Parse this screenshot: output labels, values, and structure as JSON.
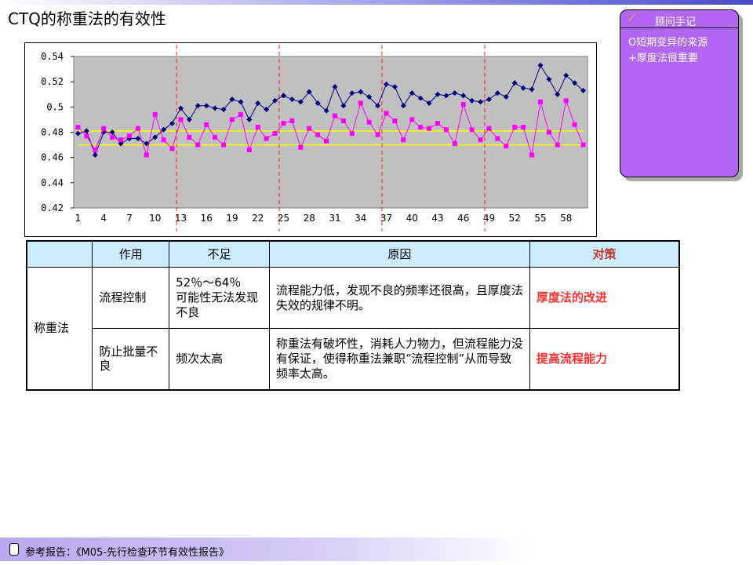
{
  "slide": {
    "title": "CTQ的称重法的有效性"
  },
  "note": {
    "header": "顾问手记",
    "lines": [
      "Ο短期变异的来源",
      "+厚度法很重要"
    ]
  },
  "chart_data": {
    "type": "line",
    "title": "",
    "xlabel": "",
    "ylabel": "",
    "ylim": [
      0.42,
      0.54
    ],
    "yticks": [
      "0.42",
      "0.44",
      "0.46",
      "0.48",
      "0.5",
      "0.52",
      "0.54"
    ],
    "xlim": [
      1,
      60
    ],
    "xticks": [
      "1",
      "4",
      "7",
      "10",
      "13",
      "16",
      "19",
      "22",
      "25",
      "28",
      "31",
      "34",
      "37",
      "40",
      "43",
      "46",
      "49",
      "52",
      "55",
      "58"
    ],
    "grid": false,
    "legend": "none",
    "plot_bg": "#c0c0c0",
    "reference_lines": [
      0.481,
      0.47
    ],
    "vertical_markers": [
      13,
      25,
      37,
      49
    ],
    "series": [
      {
        "color": "#00007f",
        "marker": "diamond",
        "x": [
          1,
          2,
          3,
          4,
          5,
          6,
          7,
          8,
          9,
          10,
          11,
          12,
          13,
          14,
          15,
          16,
          17,
          18,
          19,
          20,
          21,
          22,
          23,
          24,
          25,
          26,
          27,
          28,
          29,
          30,
          31,
          32,
          33,
          34,
          35,
          36,
          37,
          38,
          39,
          40,
          41,
          42,
          43,
          44,
          45,
          46,
          47,
          48,
          49,
          50,
          51,
          52,
          53,
          54,
          55,
          56,
          57,
          58,
          59,
          60
        ],
        "values": [
          0.479,
          0.481,
          0.462,
          0.48,
          0.48,
          0.471,
          0.475,
          0.475,
          0.471,
          0.476,
          0.482,
          0.487,
          0.499,
          0.49,
          0.501,
          0.501,
          0.499,
          0.498,
          0.506,
          0.504,
          0.49,
          0.503,
          0.498,
          0.505,
          0.509,
          0.506,
          0.504,
          0.512,
          0.503,
          0.497,
          0.516,
          0.501,
          0.511,
          0.512,
          0.508,
          0.501,
          0.518,
          0.516,
          0.501,
          0.511,
          0.507,
          0.503,
          0.51,
          0.509,
          0.511,
          0.509,
          0.505,
          0.504,
          0.506,
          0.511,
          0.508,
          0.519,
          0.515,
          0.514,
          0.533,
          0.522,
          0.51,
          0.525,
          0.519,
          0.513
        ]
      },
      {
        "color": "#ff00ff",
        "marker": "square",
        "x": [
          1,
          2,
          3,
          4,
          5,
          6,
          7,
          8,
          9,
          10,
          11,
          12,
          13,
          14,
          15,
          16,
          17,
          18,
          19,
          20,
          21,
          22,
          23,
          24,
          25,
          26,
          27,
          28,
          29,
          30,
          31,
          32,
          33,
          34,
          35,
          36,
          37,
          38,
          39,
          40,
          41,
          42,
          43,
          44,
          45,
          46,
          47,
          48,
          49,
          50,
          51,
          52,
          53,
          54,
          55,
          56,
          57,
          58,
          59,
          60
        ],
        "values": [
          0.484,
          0.477,
          0.466,
          0.483,
          0.476,
          0.474,
          0.477,
          0.483,
          0.462,
          0.494,
          0.474,
          0.467,
          0.49,
          0.476,
          0.47,
          0.486,
          0.476,
          0.47,
          0.49,
          0.494,
          0.466,
          0.484,
          0.475,
          0.479,
          0.487,
          0.489,
          0.468,
          0.483,
          0.478,
          0.473,
          0.493,
          0.489,
          0.479,
          0.503,
          0.488,
          0.478,
          0.495,
          0.489,
          0.474,
          0.49,
          0.484,
          0.483,
          0.487,
          0.482,
          0.471,
          0.502,
          0.482,
          0.474,
          0.483,
          0.475,
          0.469,
          0.484,
          0.484,
          0.462,
          0.504,
          0.48,
          0.47,
          0.505,
          0.486,
          0.47
        ]
      }
    ]
  },
  "table": {
    "headers": [
      "",
      "作用",
      "不足",
      "原因",
      "对策"
    ],
    "group_label": "称重法",
    "rows": [
      {
        "role": "流程控制",
        "lack_line1": "52％～64％",
        "lack_line2": "可能性无法发现不良",
        "reason": "流程能力低，发现不良的频率还很高，且厚度法失效的规律不明。",
        "measure": "厚度法的改进"
      },
      {
        "role": "防止批量不良",
        "lack": "频次太高",
        "reason": "称重法有破坏性，消耗人力物力，但流程能力没有保证，使得称重法兼职“流程控制”从而导致频率太高。",
        "measure": "提高流程能力"
      }
    ]
  },
  "footer": {
    "text": "参考报告：《M05-先行检查环节有效性报告》"
  }
}
